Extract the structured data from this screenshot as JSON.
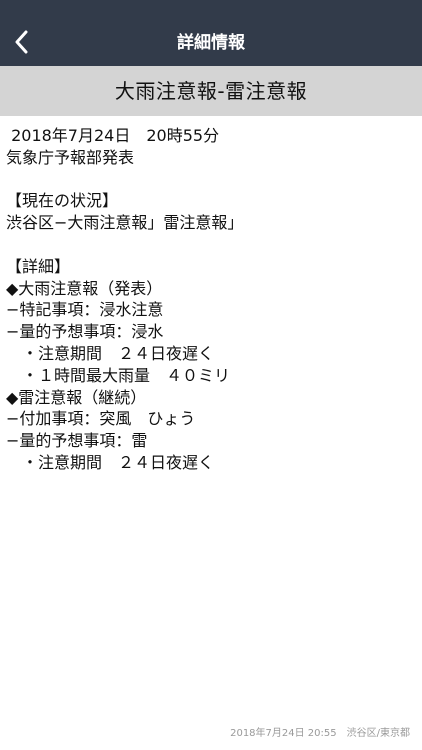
{
  "nav": {
    "title": "詳細情報",
    "back_icon": "chevron-left-icon",
    "background": "#323b4a"
  },
  "header": {
    "title": "大雨注意報-雷注意報"
  },
  "content": {
    "lines": [
      " 2018年7月24日　20時55分",
      "気象庁予報部発表",
      "",
      "【現在の状況】",
      "渋谷区−大雨注意報」雷注意報」",
      "",
      "【詳細】",
      "◆大雨注意報（発表）",
      "−特記事項：浸水注意",
      "−量的予想事項：浸水",
      "　・注意期間　２４日夜遅く",
      "　・１時間最大雨量　４０ミリ",
      "◆雷注意報（継続）",
      "−付加事項：突風　ひょう",
      "−量的予想事項：雷",
      "　・注意期間　２４日夜遅く"
    ]
  },
  "footer": {
    "text": "2018年7月24日 20:55　渋谷区/東京都"
  }
}
